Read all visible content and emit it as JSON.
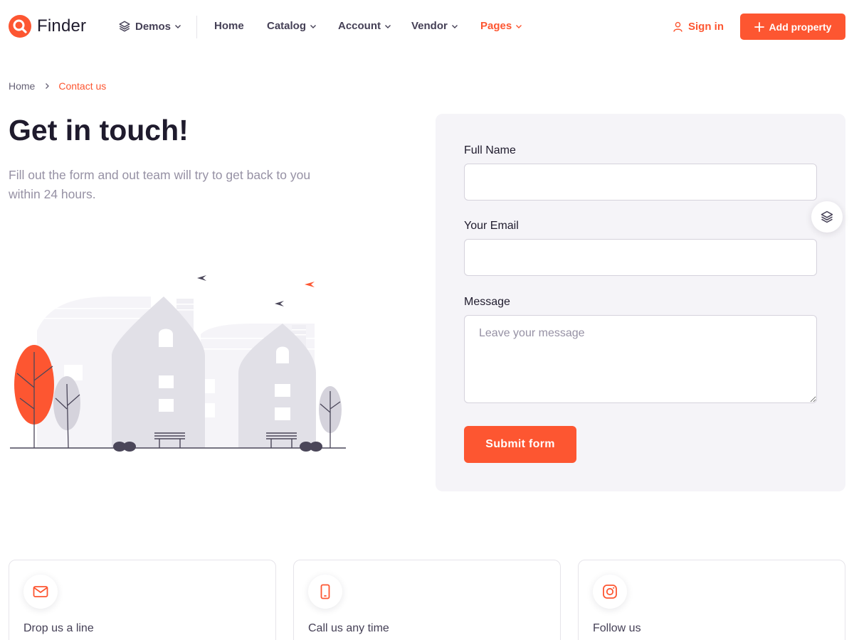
{
  "brand": {
    "name": "Finder",
    "accent_color": "#fd5631",
    "text_color": "#1f1b2d"
  },
  "nav": {
    "demos_label": "Demos",
    "items": [
      {
        "label": "Home",
        "has_dropdown": false,
        "active": false
      },
      {
        "label": "Catalog",
        "has_dropdown": true,
        "active": false
      },
      {
        "label": "Account",
        "has_dropdown": true,
        "active": false
      },
      {
        "label": "Vendor",
        "has_dropdown": true,
        "active": false
      },
      {
        "label": "Pages",
        "has_dropdown": true,
        "active": true
      }
    ],
    "signin_label": "Sign in",
    "add_property_label": "Add property"
  },
  "breadcrumb": {
    "home": "Home",
    "current": "Contact us"
  },
  "hero": {
    "title": "Get in touch!",
    "text": "Fill out the form and out team will try to get back to you within 24 hours."
  },
  "form": {
    "full_name_label": "Full Name",
    "full_name_value": "",
    "email_label": "Your Email",
    "email_value": "",
    "message_label": "Message",
    "message_placeholder": "Leave your message",
    "submit_label": "Submit form"
  },
  "contact_cards": [
    {
      "icon": "mail-icon",
      "title": "Drop us a line"
    },
    {
      "icon": "phone-icon",
      "title": "Call us any time"
    },
    {
      "icon": "instagram-icon",
      "title": "Follow us"
    }
  ],
  "icons": {
    "logo": "search-icon",
    "demos": "layers-icon",
    "signin": "user-icon",
    "add": "plus-icon",
    "floating": "layers-icon"
  }
}
